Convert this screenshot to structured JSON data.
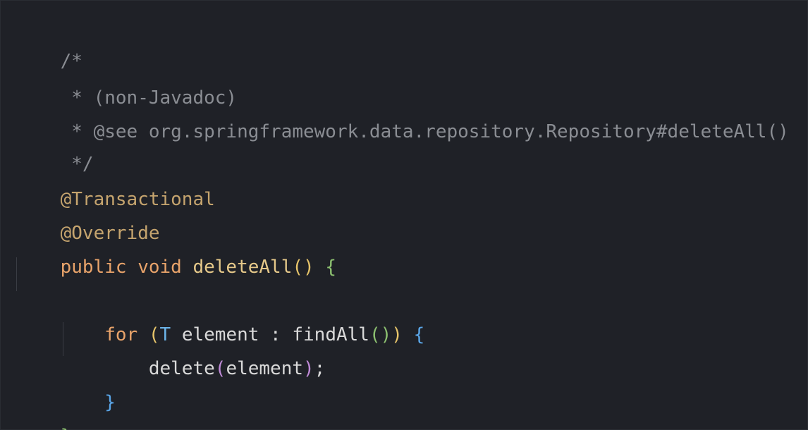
{
  "editor": {
    "lines": [
      {
        "segments": [
          {
            "text": "/*",
            "style": "comment"
          }
        ]
      },
      {
        "segments": [
          {
            "text": " * (non-Javadoc)",
            "style": "comment"
          }
        ]
      },
      {
        "segments": [
          {
            "text": " * @see org.springframework.data.repository.Repository#deleteAll()",
            "style": "comment"
          }
        ]
      },
      {
        "segments": [
          {
            "text": " */",
            "style": "comment"
          }
        ]
      },
      {
        "segments": [
          {
            "text": "@Transactional",
            "style": "annotation"
          }
        ]
      },
      {
        "segments": [
          {
            "text": "@Override",
            "style": "annotation"
          }
        ]
      },
      {
        "segments": [
          {
            "text": "public void ",
            "style": "keyword"
          },
          {
            "text": "deleteAll",
            "style": "method"
          },
          {
            "text": "()",
            "style": "bracket-gold"
          },
          {
            "text": " ",
            "style": "plain"
          },
          {
            "text": "{",
            "style": "bracket-green"
          }
        ]
      },
      {
        "segments": []
      },
      {
        "segments": [
          {
            "text": "    for ",
            "style": "keyword"
          },
          {
            "text": "(",
            "style": "bracket-gold"
          },
          {
            "text": "T",
            "style": "type"
          },
          {
            "text": " element : findAll",
            "style": "plain"
          },
          {
            "text": "()",
            "style": "bracket-green"
          },
          {
            "text": ")",
            "style": "bracket-gold"
          },
          {
            "text": " ",
            "style": "plain"
          },
          {
            "text": "{",
            "style": "bracket-blue"
          }
        ]
      },
      {
        "segments": [
          {
            "text": "        delete",
            "style": "plain"
          },
          {
            "text": "(",
            "style": "bracket-purple"
          },
          {
            "text": "element",
            "style": "plain"
          },
          {
            "text": ")",
            "style": "bracket-purple"
          },
          {
            "text": ";",
            "style": "plain"
          }
        ]
      },
      {
        "segments": [
          {
            "text": "    }",
            "style": "bracket-blue"
          }
        ]
      },
      {
        "segments": [
          {
            "text": "}",
            "style": "bracket-green"
          }
        ]
      }
    ]
  }
}
